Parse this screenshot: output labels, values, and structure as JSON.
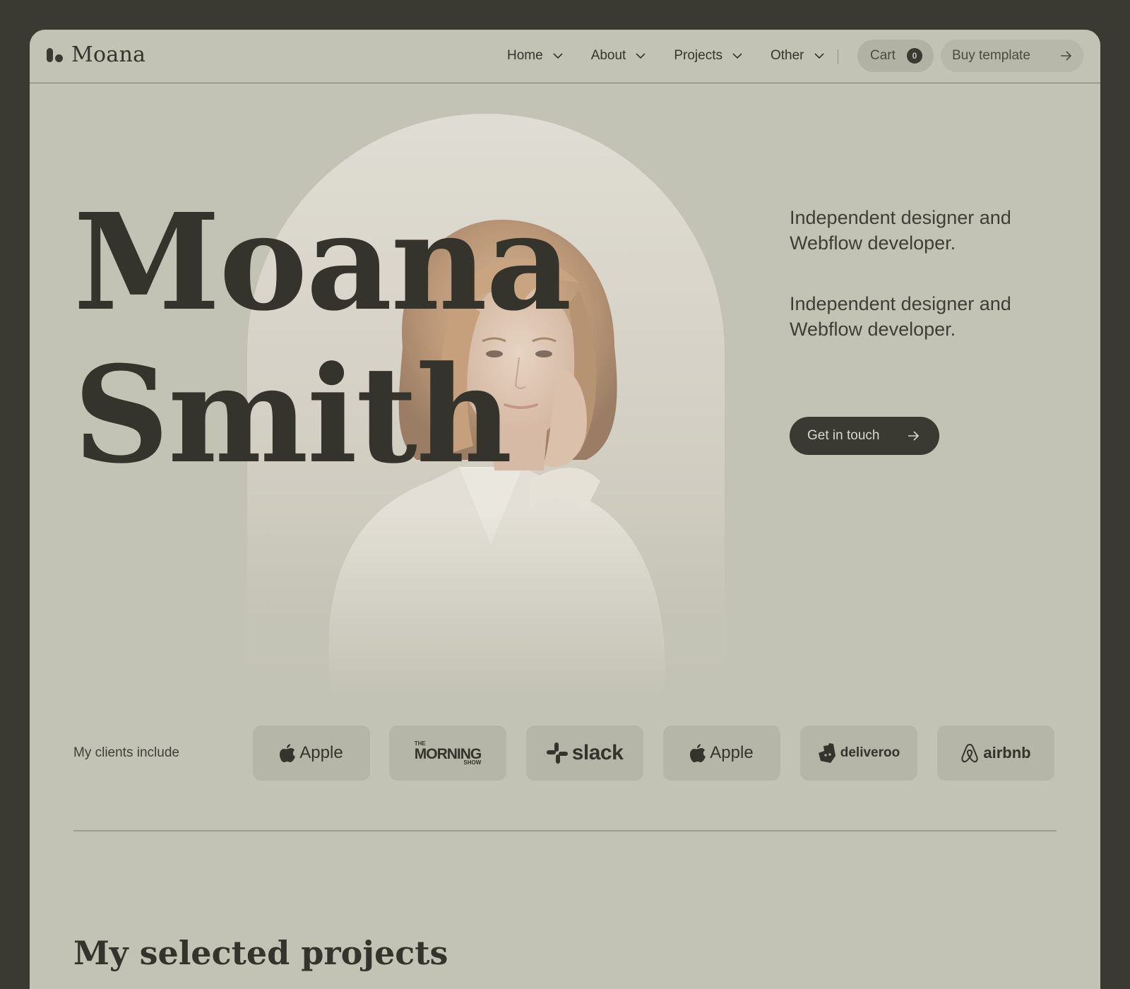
{
  "brand": {
    "name": "Moana"
  },
  "nav": {
    "items": [
      {
        "label": "Home"
      },
      {
        "label": "About"
      },
      {
        "label": "Projects"
      },
      {
        "label": "Other"
      }
    ],
    "cart_label": "Cart",
    "cart_count": "0",
    "buy_label": "Buy template"
  },
  "hero": {
    "first_name": "Moana",
    "last_name": "Smith",
    "tagline_1": "Independent designer and Webflow developer.",
    "tagline_2": "Independent designer and Webflow developer.",
    "cta_label": "Get in touch"
  },
  "clients": {
    "label": "My clients include",
    "logos": [
      {
        "name": "Apple",
        "icon": "apple-logo-icon"
      },
      {
        "name_top": "THE",
        "name": "MORNING",
        "name_bottom": "SHOW",
        "icon": "morning-show-logo"
      },
      {
        "name": "slack",
        "icon": "slack-logo-icon"
      },
      {
        "name": "Apple",
        "icon": "apple-logo-icon"
      },
      {
        "name": "deliveroo",
        "icon": "deliveroo-logo-icon"
      },
      {
        "name": "airbnb",
        "icon": "airbnb-logo-icon"
      }
    ]
  },
  "projects": {
    "title": "My selected projects"
  },
  "colors": {
    "background": "#3a3a32",
    "surface": "#c3c3b5",
    "tile": "#b5b5a8",
    "text": "#34342c"
  }
}
